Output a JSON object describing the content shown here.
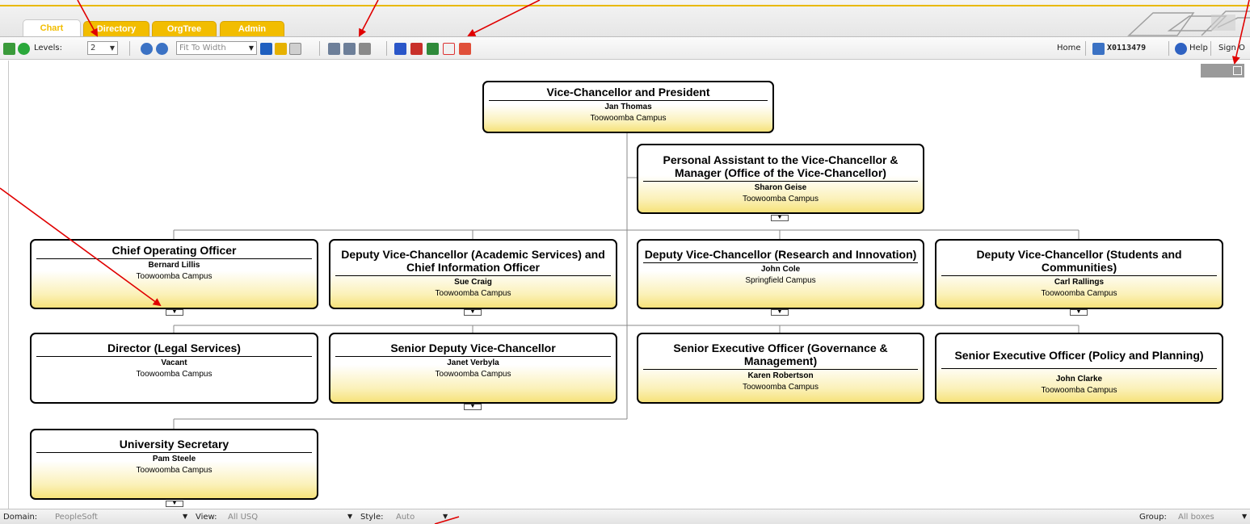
{
  "tabs": [
    {
      "label": "Chart",
      "active": true
    },
    {
      "label": "Directory",
      "active": false
    },
    {
      "label": "OrgTree",
      "active": false
    },
    {
      "label": "Admin",
      "active": false
    }
  ],
  "toolbar": {
    "levels_label": "Levels:",
    "levels_value": "2",
    "zoom_value": "Fit To Width",
    "home_label": "Home",
    "user_id": "X0113479",
    "help_label": "Help",
    "signout_label": "Sign O"
  },
  "status": {
    "domain_label": "Domain:",
    "domain_value": "PeopleSoft",
    "view_label": "View:",
    "view_value": "All USQ",
    "style_label": "Style:",
    "style_value": "Auto",
    "group_label": "Group:",
    "group_value": "All boxes"
  },
  "nodes": {
    "vc": {
      "title": "Vice-Chancellor and President",
      "person": "Jan Thomas",
      "location": "Toowoomba Campus"
    },
    "pa": {
      "title": "Personal Assistant to the Vice-Chancellor & Manager (Office of the Vice-Chancellor)",
      "person": "Sharon Geise",
      "location": "Toowoomba Campus"
    },
    "coo": {
      "title": "Chief Operating Officer",
      "person": "Bernard Lillis",
      "location": "Toowoomba Campus"
    },
    "dvc_as": {
      "title": "Deputy Vice-Chancellor (Academic Services) and Chief Information Officer",
      "person": "Sue Craig",
      "location": "Toowoomba Campus"
    },
    "dvc_ri": {
      "title": "Deputy Vice-Chancellor (Research and Innovation)",
      "person": "John Cole",
      "location": "Springfield Campus"
    },
    "dvc_sc": {
      "title": "Deputy Vice-Chancellor (Students and Communities)",
      "person": "Carl Rallings",
      "location": "Toowoomba Campus"
    },
    "legal": {
      "title": "Director (Legal Services)",
      "person": "Vacant",
      "location": "Toowoomba Campus"
    },
    "sdvc": {
      "title": "Senior Deputy Vice-Chancellor",
      "person": "Janet Verbyla",
      "location": "Toowoomba Campus"
    },
    "seo_gm": {
      "title": "Senior Executive Officer (Governance & Management)",
      "person": "Karen Robertson",
      "location": "Toowoomba Campus"
    },
    "seo_pp": {
      "title": "Senior Executive Officer (Policy and Planning)",
      "person": "John Clarke",
      "location": "Toowoomba Campus"
    },
    "us": {
      "title": "University Secretary",
      "person": "Pam Steele",
      "location": "Toowoomba Campus"
    }
  },
  "colors": {
    "accent": "#f2bd00",
    "arrow": "#e00000"
  }
}
